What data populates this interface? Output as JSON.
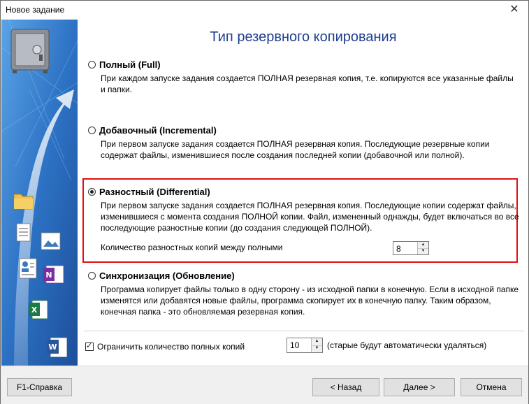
{
  "window": {
    "title": "Новое задание"
  },
  "heading": "Тип резервного копирования",
  "options": [
    {
      "title": "Полный (Full)",
      "selected": false,
      "description": "При каждом запуске задания создается ПОЛНАЯ резервная копия, т.е. копируются все указанные файлы и папки."
    },
    {
      "title": "Добавочный (Incremental)",
      "selected": false,
      "description": "При первом запуске задания создается ПОЛНАЯ резервная копия. Последующие резервные копии содержат файлы, изменившиеся после создания последней копии (добавочной или полной)."
    },
    {
      "title": "Разностный (Differential)",
      "selected": true,
      "description": "При первом запуске задания создается ПОЛНАЯ резервная копия. Последующие копии содержат файлы, изменившиеся с момента создания ПОЛНОЙ копии. Файл, измененный однажды, будет включаться во все последующие разностные копии (до создания следующей ПОЛНОЙ)."
    },
    {
      "title": "Синхронизация (Обновление)",
      "selected": false,
      "description": "Программа копирует файлы только в одну сторону - из исходной папки в конечную. Если в исходной папке изменятся или добавятся новые файлы, программа скопирует их в конечную папку. Таким образом, конечная папка - это обновляемая резервная копия."
    }
  ],
  "differential": {
    "count_label": "Количество разностных копий между полными",
    "count_value": "8"
  },
  "limit": {
    "checked": true,
    "label": "Ограничить количество полных копий",
    "value": "10",
    "hint": "(старые будут автоматически удаляться)"
  },
  "buttons": {
    "help": "F1-Справка",
    "back": "< Назад",
    "next": "Далее >",
    "cancel": "Отмена"
  },
  "colors": {
    "accent_border": "#e01010",
    "heading": "#1f3f8f",
    "side_panel": "#2f6ebd"
  },
  "icons": [
    "close-icon",
    "safe-icon",
    "folder-icon",
    "document-icon",
    "image-icon",
    "contact-card-icon",
    "onenote-icon",
    "excel-icon",
    "word-icon"
  ]
}
